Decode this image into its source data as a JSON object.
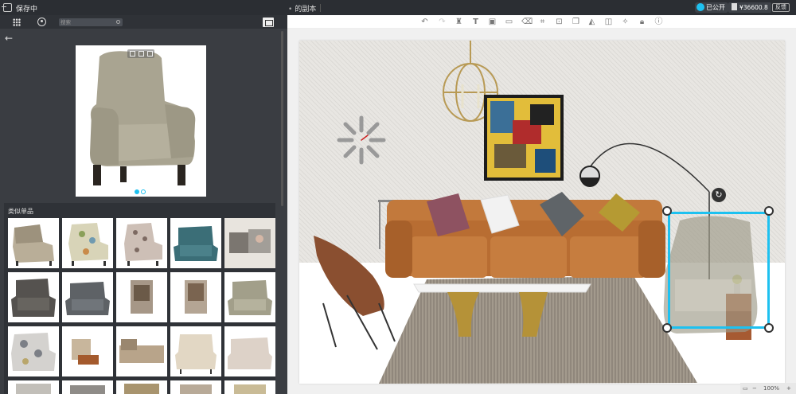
{
  "topbar": {
    "status": "保存中",
    "doc_name": "的副本",
    "publish_label": "已公开",
    "price": "¥36600.8",
    "feedback": "反馈"
  },
  "sidebar": {
    "search_placeholder": "搜索",
    "similar_title": "类似单品"
  },
  "colors": {
    "accent": "#1ec1f0",
    "dark": "#2b2e33",
    "panel": "#3a3d42"
  },
  "toolbar": {
    "icons": [
      "undo-icon",
      "redo-icon",
      "stamp-icon",
      "text-icon",
      "image-icon",
      "comment-icon",
      "trash-icon",
      "crop-icon",
      "frame-icon",
      "copy-icon",
      "flip-icon",
      "layer-icon",
      "magic-wand-icon",
      "lock-icon",
      "info-icon"
    ]
  },
  "zoom": {
    "level": "100%"
  }
}
